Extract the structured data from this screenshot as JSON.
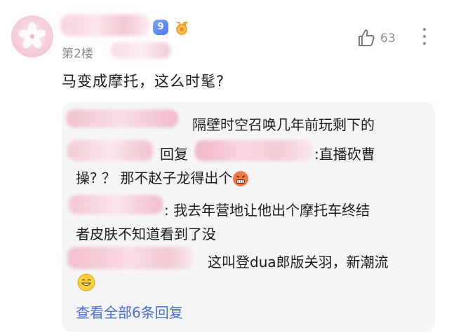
{
  "post": {
    "level": "9",
    "floor_label": "第2楼",
    "likes": "63",
    "content": "马变成摩托，这么时髦?"
  },
  "replies": [
    {
      "text": "隔壁时空召唤几年前玩剩下的"
    },
    {
      "reply_word": "回复",
      "text": ":直播砍曹",
      "text2": "操? ？ 那不赵子龙得出个"
    },
    {
      "text": ": 我去年营地让他出个摩托车终结",
      "text2": "者皮肤不知道看到了没"
    },
    {
      "text": "这叫登dua郎版关羽，新潮流"
    }
  ],
  "view_all": "查看全部6条回复",
  "colors": {
    "accent": "#4a6fd6",
    "badge": "#5b86f5",
    "reply_bg": "#f5f5f7"
  },
  "icons": [
    "like-icon",
    "more-icon",
    "level-badge",
    "medal-icon",
    "angry-emoji-icon",
    "grin-emoji-icon"
  ]
}
